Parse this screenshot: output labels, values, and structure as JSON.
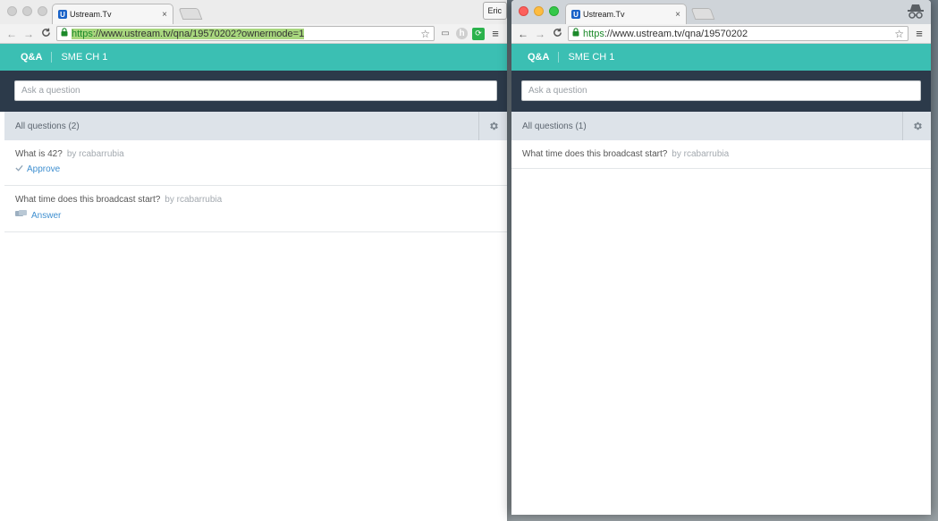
{
  "left_window": {
    "tab": {
      "favicon_letter": "U",
      "title": "Ustream.Tv",
      "close": "×"
    },
    "profile_name": "Eric",
    "nav": {
      "back": "←",
      "forward": "→",
      "reload": "C"
    },
    "address": {
      "scheme": "https",
      "rest": "://www.ustream.tv/qna/19570202?ownermode=1",
      "star": "☆"
    },
    "toolbar_icons": {
      "cast": "▭",
      "h": "h",
      "feedly": "⟳",
      "menu": "≡"
    },
    "page": {
      "nav_tab": "Q&A",
      "channel": "SME CH 1",
      "ask_placeholder": "Ask a question",
      "filter_label": "All questions (2)",
      "questions": [
        {
          "text": "What is 42?",
          "author": "by rcabarrubia",
          "action": "Approve",
          "action_icon": "check-icon"
        },
        {
          "text": "What time does this broadcast start?",
          "author": "by rcabarrubia",
          "action": "Answer",
          "action_icon": "answer-icon"
        }
      ]
    }
  },
  "right_window": {
    "tab": {
      "favicon_letter": "U",
      "title": "Ustream.Tv",
      "close": "×"
    },
    "nav": {
      "back": "←",
      "forward": "→",
      "reload": "C"
    },
    "address": {
      "scheme": "https",
      "rest": "://www.ustream.tv/qna/19570202",
      "star": "☆"
    },
    "toolbar_icons": {
      "menu": "≡"
    },
    "page": {
      "nav_tab": "Q&A",
      "channel": "SME CH 1",
      "ask_placeholder": "Ask a question",
      "filter_label": "All questions (1)",
      "questions": [
        {
          "text": "What time does this broadcast start?",
          "author": "by rcabarrubia"
        }
      ]
    }
  },
  "colors": {
    "accent_teal": "#3bbfb3",
    "dark_bar": "#2c3a4a",
    "filter_bg": "#dde3e9",
    "link_blue": "#3f8fd0"
  }
}
